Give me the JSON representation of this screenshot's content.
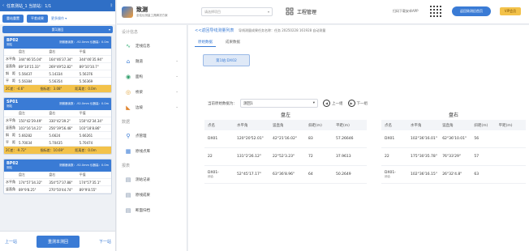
{
  "mobile": {
    "title": "任意测站_1  当前站：1/1",
    "buttons": {
      "reset": "重站重置",
      "average": "平差成果",
      "more": "更多操作"
    },
    "select_label": "第1测回",
    "cards": [
      {
        "point": "BP02",
        "sub": "测站",
        "info": "测微器读数：-92.0mm  仪器高：0.0m",
        "cols": [
          "盘左",
          "盘右",
          "平值"
        ],
        "rows": [
          {
            "k": "水平角",
            "v": [
              "344°46'35.04\"",
              "164°46'37.34\"",
              "344°46'35.94\""
            ]
          },
          {
            "k": "竖直角",
            "v": [
              "89°10'15.33\"",
              "269°49'52.82\"",
              "89°10'10.7\""
            ]
          },
          {
            "k": "斜　距",
            "v": [
              "5.56437",
              "5.14334",
              "5.56376"
            ]
          },
          {
            "k": "平　距",
            "v": [
              "5.56384",
              "5.56354",
              "5.56369"
            ]
          }
        ],
        "summary": [
          "2C差：-4.6\"",
          "指标差：3.08\"",
          "距离差：0.0m"
        ]
      },
      {
        "point": "SP01",
        "sub": "测站",
        "info": "测微器读数：-92.0mm  仪器高：0.0m",
        "cols": [
          "盘左",
          "盘右",
          "平值"
        ],
        "rows": [
          {
            "k": "水平角",
            "v": [
              "150°42'29.49\"",
              "330°42'39.2\"",
              "150°42'34.34\""
            ]
          },
          {
            "k": "竖直角",
            "v": [
              "103°16'14.21\"",
              "256°39'56.48\"",
              "103°18'8.86\""
            ]
          },
          {
            "k": "斜　距",
            "v": [
              "5.66282",
              "5.6624",
              "5.66261"
            ]
          },
          {
            "k": "平　距",
            "v": [
              "5.70034",
              "5.70435",
              "5.70474"
            ]
          }
        ],
        "summary": [
          "2C差：-9.72\"",
          "指标差：10.69\"",
          "距离差：0.0m"
        ]
      },
      {
        "point": "BP02",
        "sub": "测站",
        "info": "测微器读数：-92.0mm  仪器高：0.0m",
        "cols": [
          "盘左",
          "盘右",
          "平值"
        ],
        "rows": [
          {
            "k": "水平角",
            "v": [
              "174°57'34.32\"",
              "354°57'37.88\"",
              "174°57'35.1\""
            ]
          },
          {
            "k": "竖直角",
            "v": [
              "89°9'8.25\"",
              "270°50'44.74\"",
              "89°9'8.55\""
            ]
          }
        ],
        "summary": []
      }
    ],
    "bottom": {
      "prev": "上一站",
      "remeasure": "重测本测回",
      "next": "下一站"
    }
  },
  "header": {
    "brand_name": "致测",
    "brand_sub": "全站仪测量工具解决方案",
    "project_placeholder": "请选择项目",
    "system_name": "工程管理",
    "download_text": "扫码下载安卓APP",
    "return_button": "返回致测旧首页",
    "vip_label": "VIP会员"
  },
  "sidebar": {
    "sections": [
      {
        "title": "设计信息",
        "items": [
          {
            "label": "定线信息",
            "icon": "route-icon",
            "glyph": "∿",
            "color": "#3ab07a",
            "chev": false
          },
          {
            "label": "隧道",
            "icon": "tunnel-icon",
            "glyph": "⌂",
            "color": "#3a7bd5",
            "chev": true
          },
          {
            "label": "面构",
            "icon": "section-icon",
            "glyph": "◉",
            "color": "#2f9e6a",
            "chev": true
          },
          {
            "label": "桥梁",
            "icon": "bridge-icon",
            "glyph": "◎",
            "color": "#e0a33a",
            "chev": true
          },
          {
            "label": "边坡",
            "icon": "slope-icon",
            "glyph": "◣",
            "color": "#e0842f",
            "chev": true
          }
        ]
      },
      {
        "title": "数据",
        "items": [
          {
            "label": "点管理",
            "icon": "point-manage-icon",
            "glyph": "⚲",
            "color": "#3a7bd5",
            "chev": false
          },
          {
            "label": "原线点库",
            "icon": "point-library-icon",
            "glyph": "▦",
            "color": "#3a7bd5",
            "chev": false
          }
        ]
      },
      {
        "title": "报表",
        "items": [
          {
            "label": "测站记录",
            "icon": "station-record-icon",
            "glyph": "▤",
            "color": "#7a8ea8",
            "chev": false
          },
          {
            "label": "原线成果",
            "icon": "result-icon",
            "glyph": "▤",
            "color": "#7a8ea8",
            "chev": false
          },
          {
            "label": "断面归档",
            "icon": "archive-icon",
            "glyph": "▤",
            "color": "#7a8ea8",
            "chev": false
          }
        ]
      }
    ]
  },
  "content": {
    "breadcrumb": "<<返回导线测量列表",
    "meta": "导线测量成果任务名称：任务 20250228 161928    自动测量",
    "tabs": [
      "原始数据",
      "成果数据"
    ],
    "station_button": "第1站:DX02",
    "round_label": "当前原始数据为：",
    "round_value": "测回1",
    "prev_label": "上一组",
    "next_label": "下一组",
    "left_table": {
      "title": "盘左",
      "headers": [
        "点名",
        "水平角",
        "竖直角",
        "斜距(m)",
        "平距(m)"
      ],
      "rows": [
        [
          "DX01",
          "120°20'52.01\"",
          "42°21'16.02\"",
          "83",
          "57.26646"
        ],
        [
          "22",
          "131°2'26.12\"",
          "22°52'3.23\"",
          "72",
          "37.9613"
        ],
        [
          "DX01-\n闭合",
          "52°45'17.17\"",
          "63°36'8.96\"",
          "64",
          "50.2649"
        ]
      ]
    },
    "right_table": {
      "title": "盘右",
      "headers": [
        "点名",
        "水平角",
        "竖直角",
        "斜距(m)",
        "平距(m)"
      ],
      "rows": [
        [
          "DX01",
          "102°36'16.01\"",
          "62°36'10.01\"",
          "56",
          ""
        ],
        [
          "22",
          "175°30'35.78\"",
          "76°33'29\"",
          "57",
          ""
        ],
        [
          "DX01-\n闭合",
          "102°36'16.15\"",
          "26°32'4.8\"",
          "63",
          ""
        ]
      ]
    }
  },
  "colors": {
    "accent": "#3a7bd5",
    "warning": "#f3c24a"
  }
}
